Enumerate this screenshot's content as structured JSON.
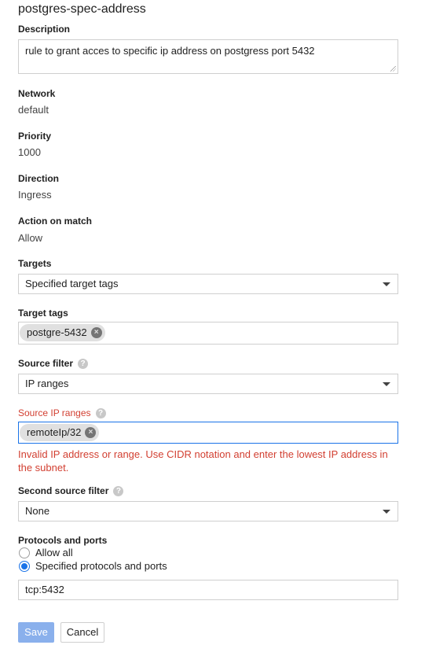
{
  "title": "postgres-spec-address",
  "description": {
    "label": "Description",
    "value": "rule to grant acces to specific ip address on postgress port 5432"
  },
  "network": {
    "label": "Network",
    "value": "default"
  },
  "priority": {
    "label": "Priority",
    "value": "1000"
  },
  "direction": {
    "label": "Direction",
    "value": "Ingress"
  },
  "action": {
    "label": "Action on match",
    "value": "Allow"
  },
  "targets": {
    "label": "Targets",
    "selected": "Specified target tags"
  },
  "target_tags": {
    "label": "Target tags",
    "chips": [
      "postgre-5432"
    ]
  },
  "source_filter": {
    "label": "Source filter",
    "selected": "IP ranges"
  },
  "source_ip_ranges": {
    "label": "Source IP ranges",
    "chips": [
      "remoteIp/32"
    ],
    "error": "Invalid IP address or range. Use CIDR notation and enter the lowest IP address in the subnet."
  },
  "second_source_filter": {
    "label": "Second source filter",
    "selected": "None"
  },
  "protocols": {
    "label": "Protocols and ports",
    "options": [
      "Allow all",
      "Specified protocols and ports"
    ],
    "selected_index": 1,
    "value": "tcp:5432"
  },
  "buttons": {
    "save": "Save",
    "cancel": "Cancel"
  },
  "icons": {
    "chip_remove": "×",
    "help": "?"
  },
  "colors": {
    "error": "#d23f31",
    "accent": "#1a73e8",
    "save_disabled": "#8ab0ec"
  }
}
